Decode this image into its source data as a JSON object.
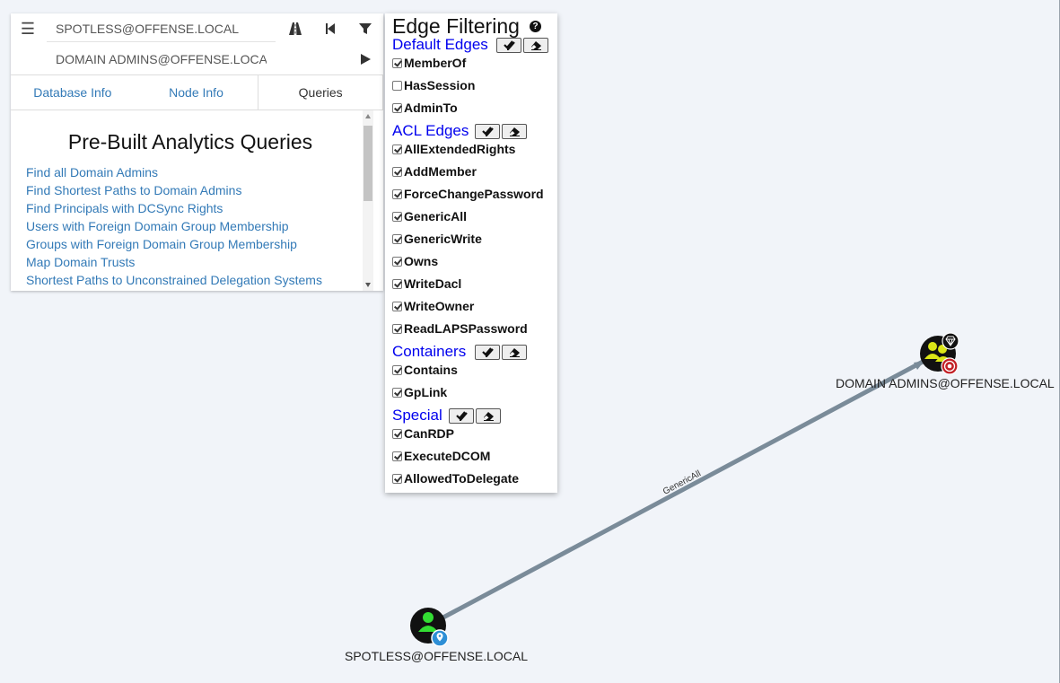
{
  "search": {
    "start_node": "SPOTLESS@OFFENSE.LOCAL",
    "target_node": "DOMAIN ADMINS@OFFENSE.LOCAL"
  },
  "tabs": [
    {
      "label": "Database Info"
    },
    {
      "label": "Node Info"
    },
    {
      "label": "Queries"
    }
  ],
  "queries": {
    "title": "Pre-Built Analytics Queries",
    "items": [
      "Find all Domain Admins",
      "Find Shortest Paths to Domain Admins",
      "Find Principals with DCSync Rights",
      "Users with Foreign Domain Group Membership",
      "Groups with Foreign Domain Group Membership",
      "Map Domain Trusts",
      "Shortest Paths to Unconstrained Delegation Systems"
    ]
  },
  "edge_filter": {
    "title": "Edge Filtering",
    "help_glyph": "?",
    "sections": [
      {
        "title": "Default Edges",
        "items": [
          {
            "label": "MemberOf",
            "checked": true
          },
          {
            "label": "HasSession",
            "checked": false
          },
          {
            "label": "AdminTo",
            "checked": true
          }
        ]
      },
      {
        "title": "ACL Edges",
        "items": [
          {
            "label": "AllExtendedRights",
            "checked": true
          },
          {
            "label": "AddMember",
            "checked": true
          },
          {
            "label": "ForceChangePassword",
            "checked": true
          },
          {
            "label": "GenericAll",
            "checked": true
          },
          {
            "label": "GenericWrite",
            "checked": true
          },
          {
            "label": "Owns",
            "checked": true
          },
          {
            "label": "WriteDacl",
            "checked": true
          },
          {
            "label": "WriteOwner",
            "checked": true
          },
          {
            "label": "ReadLAPSPassword",
            "checked": true
          }
        ]
      },
      {
        "title": "Containers",
        "items": [
          {
            "label": "Contains",
            "checked": true
          },
          {
            "label": "GpLink",
            "checked": true
          }
        ]
      },
      {
        "title": "Special",
        "items": [
          {
            "label": "CanRDP",
            "checked": true
          },
          {
            "label": "ExecuteDCOM",
            "checked": true
          },
          {
            "label": "AllowedToDelegate",
            "checked": true
          }
        ]
      }
    ]
  },
  "graph": {
    "nodes": [
      {
        "id": "user",
        "label": "SPOTLESS@OFFENSE.LOCAL",
        "kind": "user",
        "badge": "start-marker-icon",
        "color": "#33dd33"
      },
      {
        "id": "group",
        "label": "DOMAIN ADMINS@OFFENSE.LOCAL",
        "kind": "group",
        "badge": "target-icon",
        "color": "#dbe617"
      }
    ],
    "edges": [
      {
        "from": "user",
        "to": "group",
        "label": "GenericAll"
      }
    ],
    "colors": {
      "edge": "#7a8b99",
      "target_badge": "#c22026",
      "start_badge": "#2e8fd6"
    }
  }
}
